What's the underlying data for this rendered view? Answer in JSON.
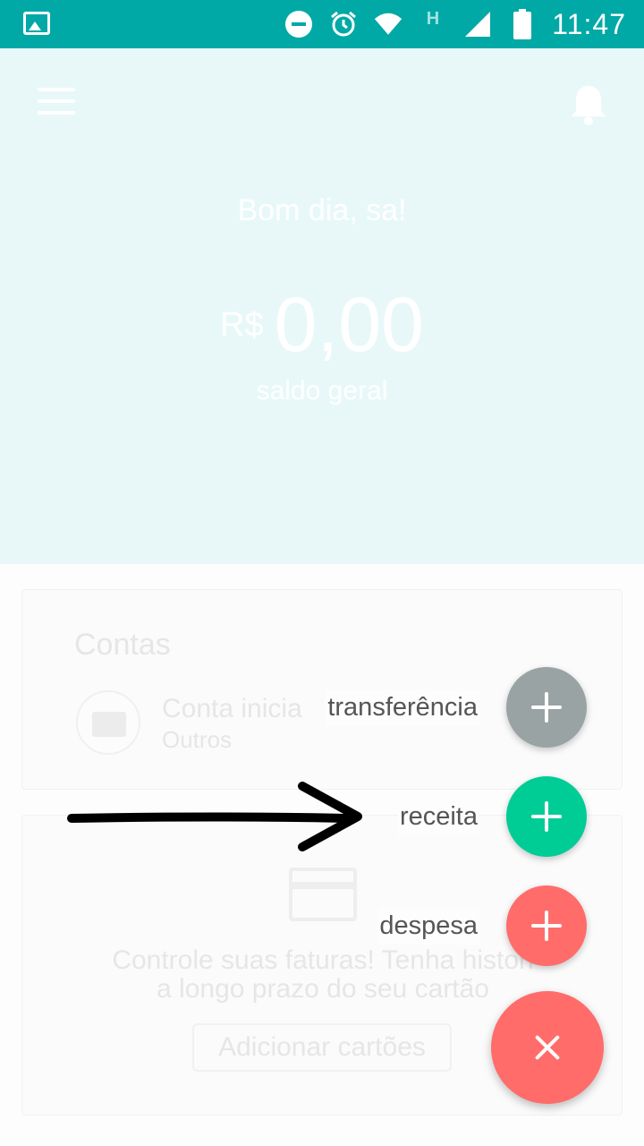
{
  "status_bar": {
    "time": "11:47",
    "icons": [
      "image-icon",
      "do-not-disturb-icon",
      "alarm-icon",
      "wifi-icon",
      "h-network-icon",
      "signal-icon",
      "battery-icon"
    ],
    "network_label": "H"
  },
  "header": {
    "greeting": "Bom dia, sa!",
    "balance_currency": "R$",
    "balance_amount": "0,00",
    "balance_label": "saldo geral"
  },
  "accounts_card": {
    "title": "Contas",
    "account_name": "Conta inicia",
    "account_type": "Outros"
  },
  "cards_card": {
    "text_line1": "Controle suas faturas! Tenha histori",
    "text_line2": "a longo prazo do seu cartão",
    "button": "Adicionar cartões"
  },
  "fab_menu": {
    "items": [
      {
        "label": "transferência",
        "color": "#9aa3a3"
      },
      {
        "label": "receita",
        "color": "#00cc96"
      },
      {
        "label": "despesa",
        "color": "#ff6c6a"
      }
    ],
    "main_color": "#ff6c6a"
  },
  "colors": {
    "status_bar": "#00a9a6",
    "hero_bg": "#e8f8f8"
  }
}
